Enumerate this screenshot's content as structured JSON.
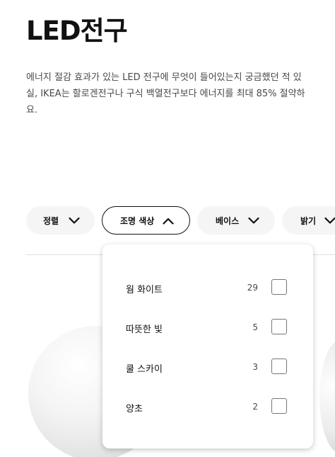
{
  "page": {
    "title": "LED전구",
    "description_line1": "에너지 절감 효과가 있는 LED 전구에 무엇이 들어있는지 궁금했던 적 있",
    "description_line2": "실, IKEA는 할로겐전구나 구식 백열전구보다 에너지를 최대 85% 절약하",
    "description_line3": "요."
  },
  "filters": {
    "sort_label": "정렬",
    "color_label": "조명 색상",
    "base_label": "베이스",
    "brightness_label": "밝기"
  },
  "color_dropdown": {
    "options": [
      {
        "label": "웜 화이트",
        "count": "29"
      },
      {
        "label": "따뜻한 빛",
        "count": "5"
      },
      {
        "label": "쿨 스카이",
        "count": "3"
      },
      {
        "label": "양초",
        "count": "2"
      }
    ]
  },
  "icons": {
    "chevron_down": "chevron-down-icon",
    "chevron_up": "chevron-up-icon",
    "checkbox": "checkbox-icon"
  },
  "colors": {
    "pill_bg": "#f5f5f5",
    "text": "#111111",
    "muted_text": "#484848",
    "divider": "#dfdfdf"
  }
}
